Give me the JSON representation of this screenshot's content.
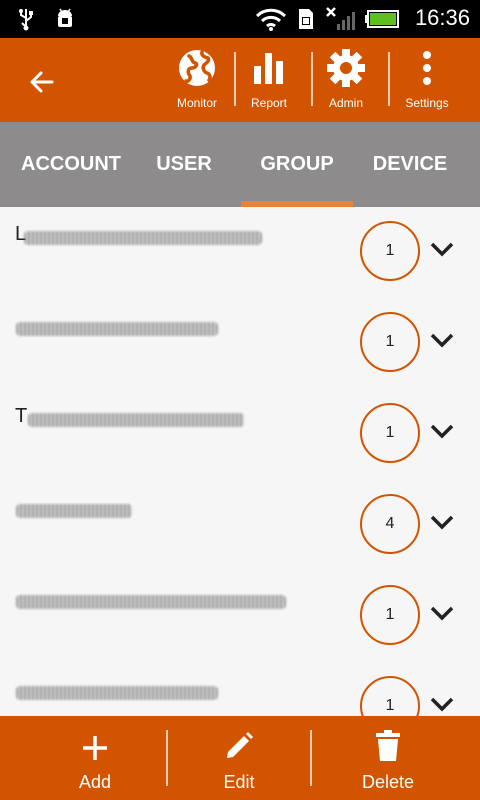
{
  "status_bar": {
    "time": "16:36"
  },
  "toolbar": {
    "items": [
      {
        "label": "Monitor",
        "icon": "globe-icon"
      },
      {
        "label": "Report",
        "icon": "bar-chart-icon"
      },
      {
        "label": "Admin",
        "icon": "gear-icon"
      },
      {
        "label": "Settings",
        "icon": "more-vertical-icon"
      }
    ]
  },
  "tabs": [
    {
      "label": "ACCOUNT",
      "active": false
    },
    {
      "label": "USER",
      "active": false
    },
    {
      "label": "GROUP",
      "active": true
    },
    {
      "label": "DEVICE",
      "active": false
    }
  ],
  "groups": [
    {
      "name_visible": "L",
      "count": "1"
    },
    {
      "name_visible": "",
      "count": "1"
    },
    {
      "name_visible": "T",
      "count": "1"
    },
    {
      "name_visible": "",
      "count": "4"
    },
    {
      "name_visible": "",
      "count": "1"
    },
    {
      "name_visible": "",
      "count": "1"
    }
  ],
  "bottom_bar": {
    "add_label": "Add",
    "edit_label": "Edit",
    "delete_label": "Delete"
  },
  "colors": {
    "accent": "#d35400",
    "tab_bg": "#8d8b8b",
    "tab_indicator": "#e8833a"
  }
}
